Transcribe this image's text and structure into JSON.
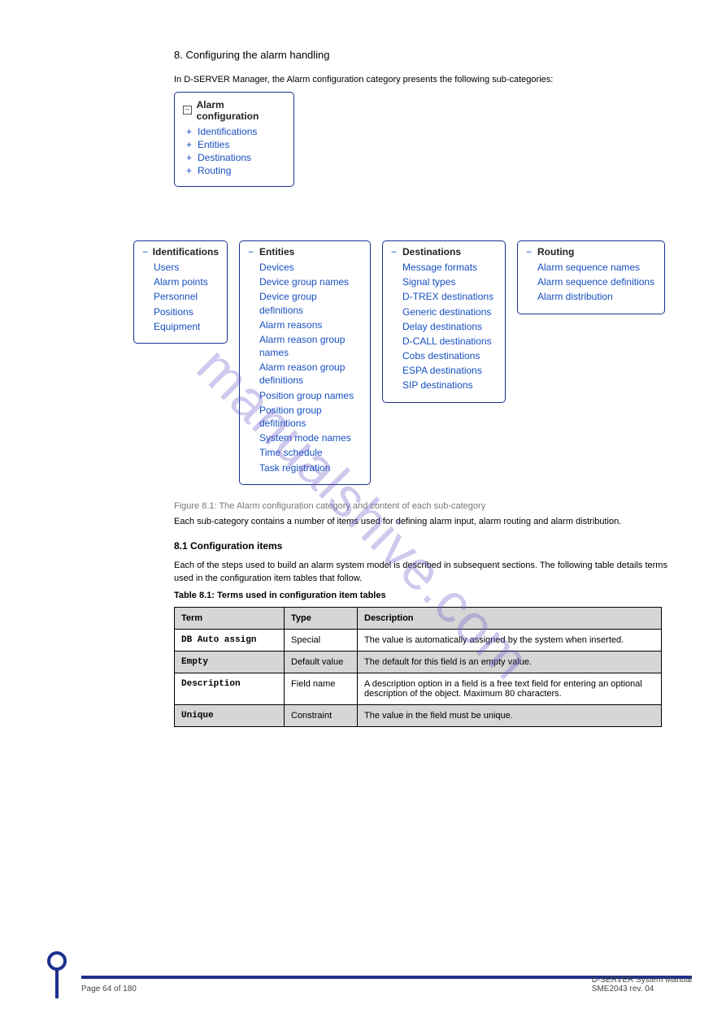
{
  "header": {
    "section_title": "8. Configuring the alarm handling",
    "intro": "In D-SERVER Manager, the Alarm configuration category presents the following sub-categories:"
  },
  "catbox": {
    "title": "Alarm configuration",
    "items": [
      "Identifications",
      "Entities",
      "Destinations",
      "Routing"
    ]
  },
  "subboxes": {
    "identifications": {
      "title": "Identifications",
      "items": [
        "Users",
        "Alarm points",
        "Personnel",
        "Positions",
        "Equipment"
      ]
    },
    "entities": {
      "title": "Entities",
      "items": [
        "Devices",
        "Device group names",
        "Device group definitions",
        "Alarm reasons",
        "Alarm reason group names",
        "Alarm reason group definitions",
        "Position group names",
        "Position group defitintions",
        "System mode names",
        "Time schedule",
        "Task registration"
      ]
    },
    "destinations": {
      "title": "Destinations",
      "items": [
        "Message formats",
        "Signal types",
        "D-TREX destinations",
        "Generic destinations",
        "Delay destinations",
        "D-CALL destinations",
        "Cobs destinations",
        "ESPA destinations",
        "SIP destinations"
      ]
    },
    "routing": {
      "title": "Routing",
      "items": [
        "Alarm sequence names",
        "Alarm sequence definitions",
        "Alarm distribution"
      ]
    }
  },
  "fig_caption": "Figure 8.1: The Alarm configuration category and content of each sub-category",
  "para_1": "Each sub-category contains a number of items used for defining alarm input, alarm routing and alarm distribution.",
  "conf_items": {
    "heading": "8.1 Configuration items",
    "text": "Each of the steps used to build an alarm system model is described in subsequent sections. The following table details terms used in the configuration item tables that follow."
  },
  "terms_table": {
    "caption": "Table 8.1:  Terms used in configuration item tables",
    "headers": [
      "Term",
      "Type",
      "Description"
    ],
    "rows": [
      [
        "DB Auto assign",
        "Special",
        "The value is automatically assigned by the system when inserted."
      ],
      [
        "Empty",
        "Default value",
        "The default for this field is an empty value."
      ],
      [
        "Description",
        "Field name",
        "A description option in a field is a free text field for entering an optional description of the object. Maximum 80 characters."
      ],
      [
        "Unique",
        "Constraint",
        "The value in the field must be unique."
      ]
    ]
  },
  "watermark": "manualshive.com",
  "footer": {
    "left": "Page 64 of 180",
    "right_doc": "D-SERVER System Manual",
    "right_ver": "SME2043 rev. 04"
  }
}
